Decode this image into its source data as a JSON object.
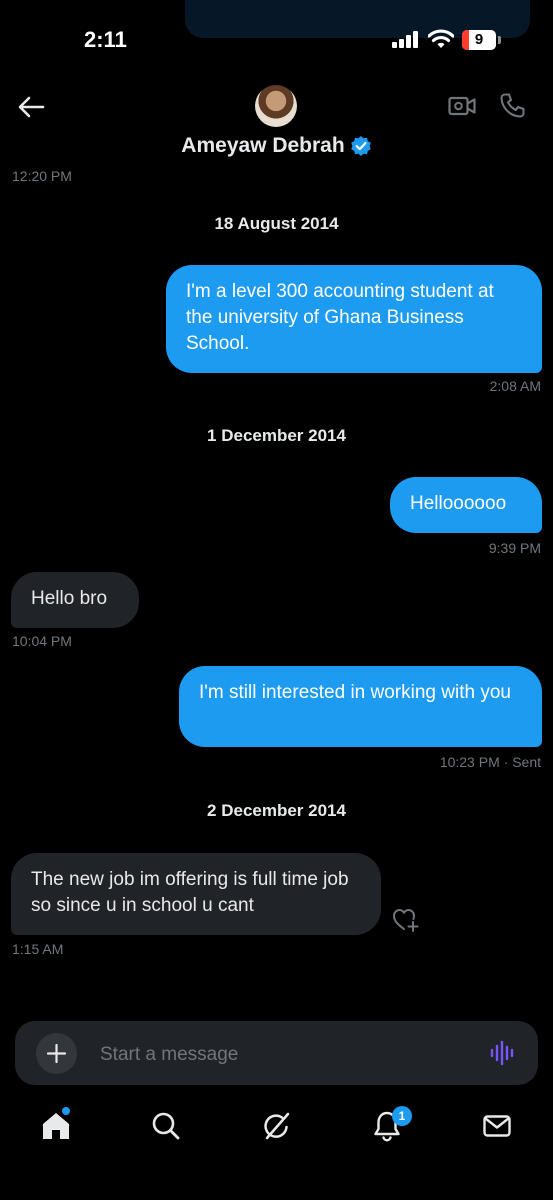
{
  "status_bar": {
    "time": "2:11",
    "battery_level": "9"
  },
  "header": {
    "contact_name": "Ameyaw Debrah",
    "verified": true
  },
  "conversation": {
    "top_timestamp": "12:20 PM",
    "groups": [
      {
        "date": "18 August 2014",
        "messages": [
          {
            "direction": "sent",
            "text": "I'm a level 300 accounting student at the university of Ghana Business School.",
            "time": "2:08 AM"
          }
        ]
      },
      {
        "date": "1 December 2014",
        "messages": [
          {
            "direction": "sent",
            "text": "Helloooooo",
            "time": "9:39 PM"
          },
          {
            "direction": "received",
            "text": "Hello bro",
            "time": "10:04 PM"
          },
          {
            "direction": "sent",
            "text": "I'm still interested in working with you",
            "time": "10:23 PM",
            "status": "· Sent"
          }
        ]
      },
      {
        "date": "2 December 2014",
        "messages": [
          {
            "direction": "received",
            "text": "The new job im offering is full time job so since u in school u cant",
            "time": "1:15 AM"
          }
        ]
      }
    ]
  },
  "composer": {
    "placeholder": "Start a message"
  },
  "tabbar": {
    "items": [
      "home-icon",
      "search-icon",
      "grok-icon",
      "bell-icon",
      "mail-icon"
    ],
    "notifications_badge": "1"
  },
  "colors": {
    "accent": "#1d9bf0",
    "background": "#000000",
    "received_bubble": "#202327",
    "muted_text": "#71767b"
  }
}
